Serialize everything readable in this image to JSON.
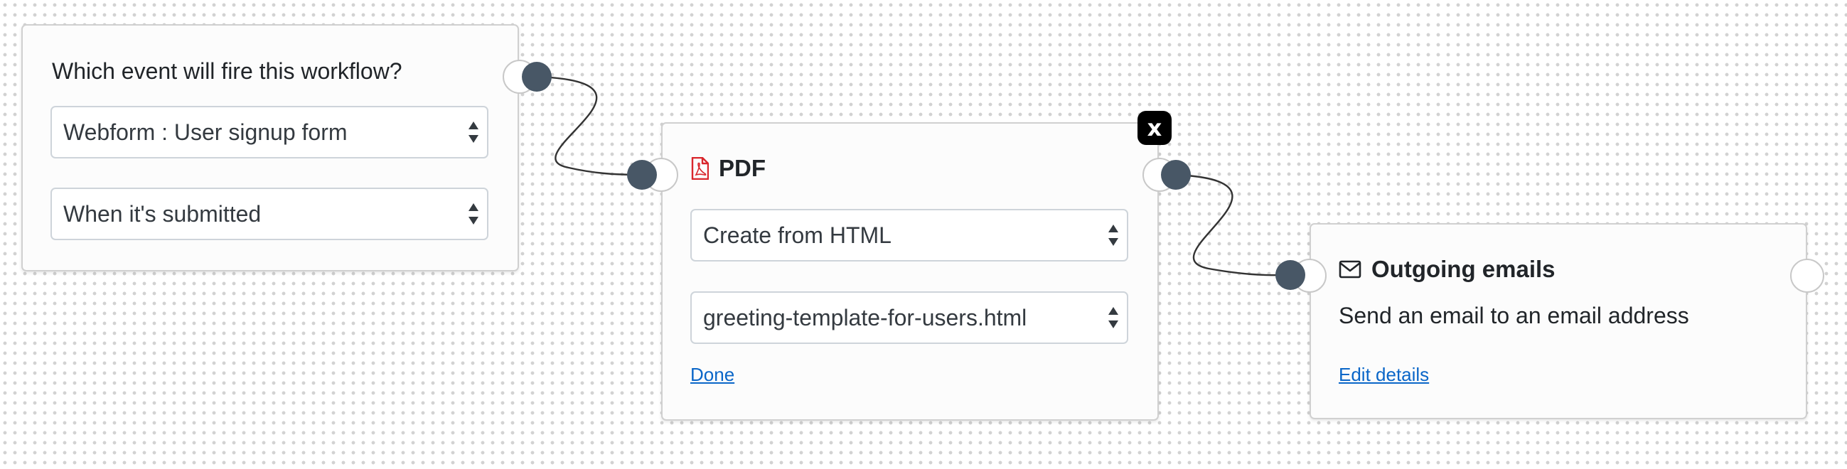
{
  "trigger": {
    "title": "Which event will fire this workflow?",
    "event_select": "Webform : User signup form",
    "when_select": "When it's submitted"
  },
  "pdf_node": {
    "title": "PDF",
    "icon": "file-pdf-icon",
    "icon_color": "#d9262c",
    "mode_select": "Create from HTML",
    "template_select": "greeting-template-for-users.html",
    "done_link": "Done",
    "close_label": "x"
  },
  "email_node": {
    "title": "Outgoing emails",
    "icon": "envelope-icon",
    "description": "Send an email to an email address",
    "edit_link": "Edit details"
  },
  "colors": {
    "connector_dot": "#485766",
    "link": "#0a66c8",
    "node_border": "#d0d0d0",
    "dot_grid": "#d2d2d2"
  }
}
